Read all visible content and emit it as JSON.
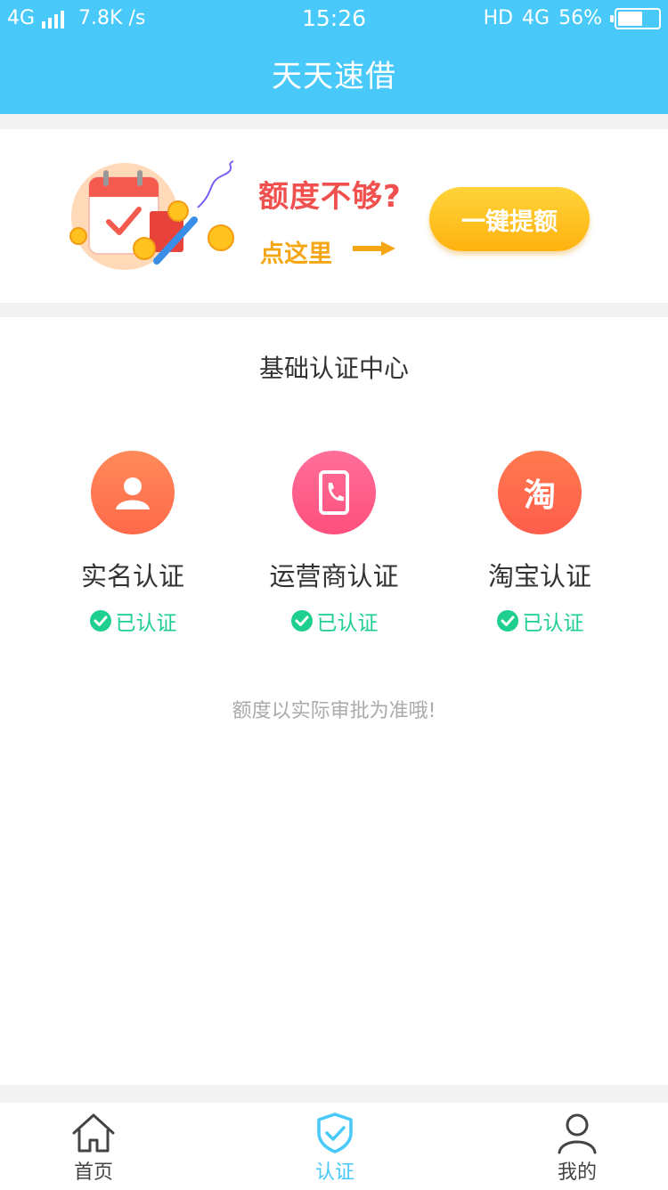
{
  "status_bar": {
    "network": "4G",
    "speed": "7.8K /s",
    "time": "15:26",
    "hd": "HD",
    "network_right": "4G",
    "battery": "56%",
    "battery_level": 0.56
  },
  "header": {
    "title": "天天速借"
  },
  "banner": {
    "question": "额度不够?",
    "hint": "点这里",
    "button_label": "一键提额"
  },
  "certification": {
    "title": "基础认证中心",
    "items": [
      {
        "name": "实名认证",
        "status": "已认证",
        "icon": "person-icon",
        "color": "#ff7a52"
      },
      {
        "name": "运营商认证",
        "status": "已认证",
        "icon": "phone-icon",
        "color": "#ff5f8a"
      },
      {
        "name": "淘宝认证",
        "status": "已认证",
        "icon": "taobao-icon",
        "icon_text": "淘",
        "color": "#ff6a4c"
      }
    ],
    "note": "额度以实际审批为准哦!"
  },
  "tabbar": {
    "tabs": [
      {
        "label": "首页",
        "icon": "home-icon"
      },
      {
        "label": "认证",
        "icon": "shield-check-icon",
        "active": true
      },
      {
        "label": "我的",
        "icon": "user-icon"
      }
    ]
  },
  "colors": {
    "primary": "#48c9fa",
    "verified": "#1fcf8f",
    "button": "#ffc21f",
    "question": "#f0504e"
  }
}
